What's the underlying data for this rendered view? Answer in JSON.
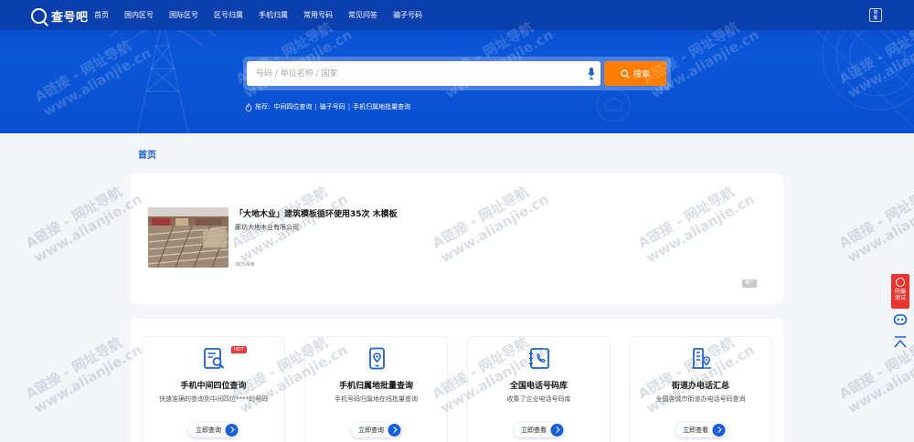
{
  "header": {
    "logo_text": "查号吧",
    "nav": [
      "首页",
      "国内区号",
      "国际区号",
      "区号归属",
      "手机归属",
      "常用号码",
      "常见问答",
      "骗子号码"
    ],
    "lang_label": "简\n繁"
  },
  "search": {
    "placeholder": "号码 / 单位名称 / 国家",
    "button_label": "搜索"
  },
  "recommend": {
    "label": "推荐:",
    "links": [
      "中间四位查询",
      "骗子号码",
      "手机归属地批量查询"
    ]
  },
  "breadcrumb": "首页",
  "ad": {
    "title": "「大地木业」建筑模板循环使用35次 木模板",
    "company": "廊坊大地木业有限公司",
    "views": "38万阅读",
    "tag": "推广"
  },
  "tools": [
    {
      "title": "手机中间四位查询",
      "desc": "快速准确的查询到中间四位****的号码",
      "button": "立即查询",
      "icon": "phone-search-icon",
      "badge": "HOT"
    },
    {
      "title": "手机归属地批量查询",
      "desc": "手机号码归属地在线批量查询",
      "button": "立即查询",
      "icon": "mobile-location-icon",
      "badge": ""
    },
    {
      "title": "全国电话号码库",
      "desc": "收集了企业电话号码库",
      "button": "立即查看",
      "icon": "phone-book-icon",
      "badge": ""
    },
    {
      "title": "街道办电话汇总",
      "desc": "全国各城市街道办电话号码查询",
      "button": "立即查看",
      "icon": "building-location-icon",
      "badge": ""
    }
  ],
  "float_bar": {
    "test_label": "防骗\n测试"
  },
  "watermark": {
    "line1": "A链接 - 网址导航",
    "line2": "www.alianjie.cn"
  },
  "colors": {
    "primary": "#0a4fcf",
    "accent": "#ff7d00",
    "hot": "#f0393a",
    "link": "#1a5fd8"
  }
}
